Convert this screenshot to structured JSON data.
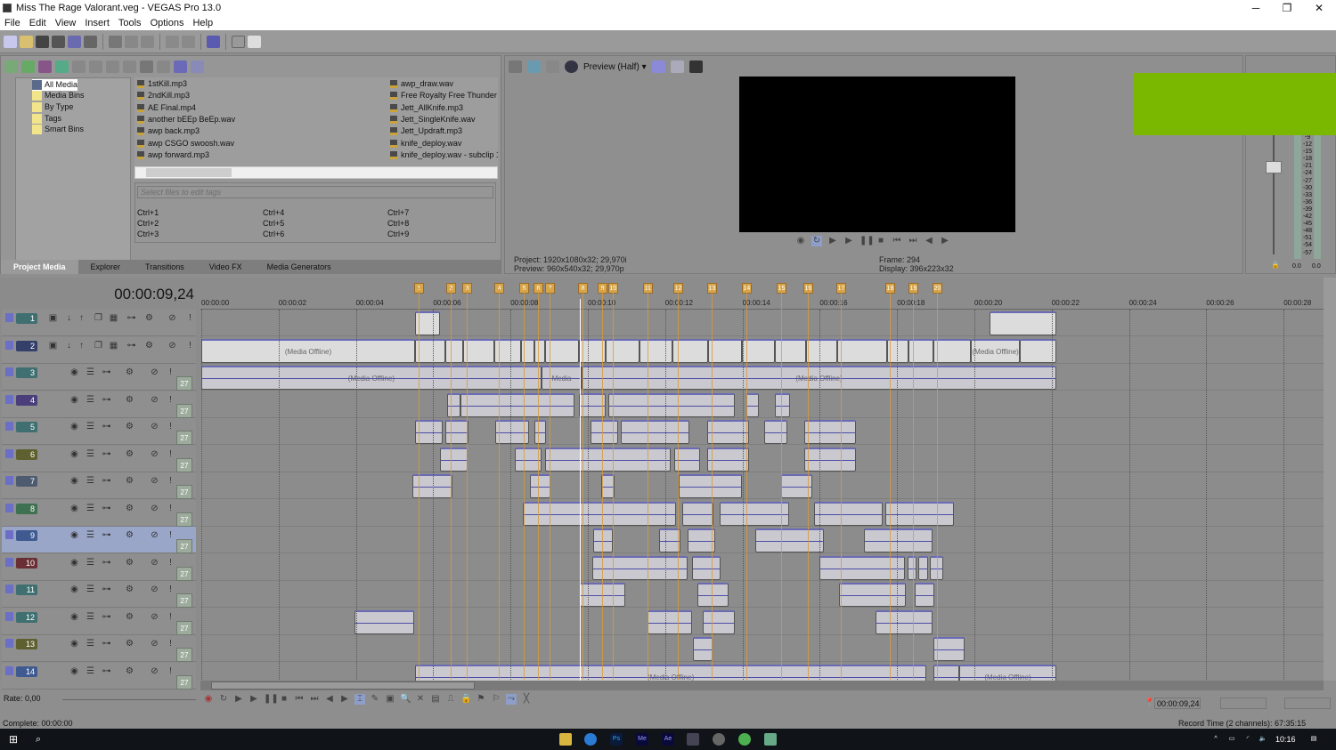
{
  "window": {
    "title": "Miss The Rage Valorant.veg - VEGAS Pro 13.0",
    "minimize": "─",
    "maximize": "❐",
    "close": "✕"
  },
  "menu": [
    "File",
    "Edit",
    "View",
    "Insert",
    "Tools",
    "Options",
    "Help"
  ],
  "media": {
    "tree": [
      "All Media",
      "Media Bins",
      "By Type",
      "Tags",
      "Smart Bins"
    ],
    "files_col1": [
      "1stKill.mp3",
      "2ndKill.mp3",
      "AE Final.mp4",
      "another bEEp BeEp.wav",
      "awp back.mp3",
      "awp CSGO swoosh.wav",
      "awp forward.mp3"
    ],
    "files_col2": [
      "awp_draw.wav",
      "Free Royalty Free Thunder a",
      "Jett_AllKnife.mp3",
      "Jett_SingleKnife.wav",
      "Jett_Updraft.mp3",
      "knife_deploy.wav",
      "knife_deploy.wav - subclip 1"
    ],
    "tags_placeholder": "Select files to edit tags",
    "hotkeys": [
      "Ctrl+1",
      "Ctrl+2",
      "Ctrl+3",
      "Ctrl+4",
      "Ctrl+5",
      "Ctrl+6",
      "Ctrl+7",
      "Ctrl+8",
      "Ctrl+9"
    ],
    "tabs": [
      "Project Media",
      "Explorer",
      "Transitions",
      "Video FX",
      "Media Generators"
    ],
    "active_tab": "Project Media"
  },
  "preview": {
    "quality": "Preview (Half)",
    "project_label": "Project:",
    "project": "1920x1080x32; 29,970i",
    "preview_label": "Preview:",
    "preview": "960x540x32; 29,970p",
    "frame_label": "Frame:",
    "frame": "294",
    "display_label": "Display:",
    "display": "396x223x32"
  },
  "meter": {
    "scale": [
      "-9",
      "-12",
      "-15",
      "-18",
      "-21",
      "-24",
      "-27",
      "-30",
      "-33",
      "-36",
      "-39",
      "-42",
      "-45",
      "-48",
      "-51",
      "-54",
      "-57"
    ],
    "left": "0.0",
    "right": "0.0"
  },
  "overlay_color": "#7ab800",
  "timeline": {
    "timecode": "00:00:09,24",
    "cursor_seconds": 9.8,
    "ruler": [
      "00:00:00",
      "00:00:02",
      "00:00:04",
      "00:00:06",
      "00:00:08",
      "00:00:10",
      "00:00:12",
      "00:00:14",
      "00:00:16",
      "00:00:18",
      "00:00:20",
      "00:00:22",
      "00:00:24",
      "00:00:26",
      "00:00:28"
    ],
    "markers": [
      {
        "n": "1",
        "t": 5.62
      },
      {
        "n": "2",
        "t": 6.45
      },
      {
        "n": "3",
        "t": 6.87
      },
      {
        "n": "4",
        "t": 7.7
      },
      {
        "n": "5",
        "t": 8.34
      },
      {
        "n": "6",
        "t": 8.71
      },
      {
        "n": "7",
        "t": 9.01
      },
      {
        "n": "8",
        "t": 9.86
      },
      {
        "n": "9",
        "t": 10.37
      },
      {
        "n": "10",
        "t": 10.64
      },
      {
        "n": "11",
        "t": 11.54
      },
      {
        "n": "12",
        "t": 12.33
      },
      {
        "n": "13",
        "t": 13.2
      },
      {
        "n": "14",
        "t": 14.1
      },
      {
        "n": "15",
        "t": 15.0
      },
      {
        "n": "16",
        "t": 15.69
      },
      {
        "n": "17",
        "t": 16.54
      },
      {
        "n": "18",
        "t": 17.81
      },
      {
        "n": "19",
        "t": 18.41
      },
      {
        "n": "20",
        "t": 19.03
      }
    ],
    "tracks": [
      {
        "n": "1",
        "type": "video",
        "color": "#3f6f70",
        "clips": [
          [
            5.53,
            6.18
          ],
          [
            20.39,
            22.12
          ]
        ]
      },
      {
        "n": "2",
        "type": "video",
        "color": "#343f6a",
        "clips": [
          [
            0,
            5.53,
            "(Media Offline)"
          ],
          [
            5.53,
            6.31
          ],
          [
            6.31,
            6.77
          ],
          [
            6.77,
            7.58
          ],
          [
            7.58,
            8.27
          ],
          [
            8.27,
            8.62
          ],
          [
            8.62,
            8.89
          ],
          [
            8.89,
            9.77
          ],
          [
            9.77,
            10.46
          ],
          [
            10.46,
            11.34
          ],
          [
            11.34,
            12.19
          ],
          [
            12.19,
            13.11
          ],
          [
            13.11,
            13.99
          ],
          [
            13.99,
            14.84
          ],
          [
            14.84,
            15.65
          ],
          [
            15.65,
            16.45
          ],
          [
            16.45,
            17.74
          ],
          [
            17.74,
            18.29
          ],
          [
            18.29,
            18.94
          ],
          [
            18.94,
            19.91
          ],
          [
            19.91,
            21.18,
            "(Media Offline)"
          ],
          [
            21.18,
            22.12
          ]
        ]
      },
      {
        "n": "3",
        "type": "audio",
        "color": "#3f6f70",
        "clips": [
          [
            0,
            8.8,
            "(Media Offline)"
          ],
          [
            8.8,
            9.84,
            "Media"
          ],
          [
            9.84,
            22.12,
            "(Media Offline)"
          ]
        ]
      },
      {
        "n": "4",
        "type": "audio",
        "color": "#4a3f7a",
        "clips": [
          [
            6.36,
            6.71
          ],
          [
            6.71,
            9.65
          ],
          [
            9.77,
            10.46
          ],
          [
            10.53,
            13.8
          ],
          [
            14.1,
            14.42
          ],
          [
            14.84,
            15.23
          ]
        ]
      },
      {
        "n": "5",
        "type": "audio",
        "color": "#3f6f70",
        "clips": [
          [
            5.53,
            6.24
          ],
          [
            6.31,
            6.91
          ],
          [
            7.6,
            8.48
          ],
          [
            8.62,
            8.92
          ],
          [
            10.07,
            10.78
          ],
          [
            10.85,
            12.63
          ],
          [
            13.09,
            14.17
          ],
          [
            14.56,
            15.16
          ],
          [
            15.6,
            16.94
          ]
        ]
      },
      {
        "n": "6",
        "type": "audio",
        "color": "#5f6030",
        "clips": [
          [
            6.18,
            6.89
          ],
          [
            8.11,
            8.8
          ],
          [
            8.89,
            12.14
          ],
          [
            12.24,
            12.9
          ],
          [
            13.09,
            14.17
          ],
          [
            15.6,
            16.94
          ]
        ]
      },
      {
        "n": "7",
        "type": "audio",
        "color": "#4d5a70",
        "clips": [
          [
            5.46,
            6.5
          ],
          [
            8.5,
            9.03
          ],
          [
            10.35,
            10.69
          ],
          [
            12.35,
            13.99
          ],
          [
            15.0,
            15.81
          ]
        ]
      },
      {
        "n": "8",
        "type": "audio",
        "color": "#3f7050",
        "clips": [
          [
            8.32,
            12.28
          ],
          [
            12.44,
            13.25
          ],
          [
            13.41,
            15.21
          ],
          [
            15.85,
            17.63
          ],
          [
            17.7,
            19.47
          ]
        ]
      },
      {
        "n": "9",
        "type": "audio",
        "color": "#3e5a90",
        "selected": true,
        "clips": [
          [
            10.14,
            10.65
          ],
          [
            11.84,
            12.4
          ],
          [
            12.58,
            13.29
          ],
          [
            14.33,
            16.11
          ],
          [
            17.14,
            18.92
          ]
        ]
      },
      {
        "n": "10",
        "type": "audio",
        "color": "#6a2f35",
        "clips": [
          [
            10.12,
            12.58
          ],
          [
            12.7,
            13.43
          ],
          [
            15.99,
            18.2
          ],
          [
            18.27,
            18.5
          ],
          [
            18.55,
            18.8
          ],
          [
            18.85,
            19.19
          ]
        ]
      },
      {
        "n": "11",
        "type": "audio",
        "color": "#3f6f70",
        "clips": [
          [
            9.79,
            10.97
          ],
          [
            12.83,
            13.64
          ],
          [
            16.5,
            18.23
          ],
          [
            18.46,
            18.96
          ]
        ]
      },
      {
        "n": "12",
        "type": "audio",
        "color": "#3f6f70",
        "clips": [
          [
            3.96,
            5.51
          ],
          [
            11.54,
            12.7
          ],
          [
            12.97,
            13.8
          ],
          [
            17.44,
            18.92
          ]
        ]
      },
      {
        "n": "13",
        "type": "audio",
        "color": "#5f6030",
        "clips": [
          [
            12.72,
            13.23
          ],
          [
            18.94,
            19.75
          ]
        ]
      },
      {
        "n": "14",
        "type": "audio",
        "color": "#3e5a90",
        "clips": [
          [
            5.53,
            18.76,
            "(Media Offline)"
          ],
          [
            18.94,
            19.61
          ],
          [
            19.61,
            22.12,
            "(Media Offline)"
          ]
        ]
      }
    ],
    "track_volume": "27"
  },
  "transport": {
    "rate": "Rate: 0,00",
    "cursor_time": "00:00:09,24"
  },
  "status": {
    "left": "Complete: 00:00:00",
    "right": "Record Time (2 channels): 67:35:15"
  },
  "taskbar": {
    "apps": [
      "Ps",
      "Me",
      "Ae"
    ],
    "clock": "10:16"
  }
}
